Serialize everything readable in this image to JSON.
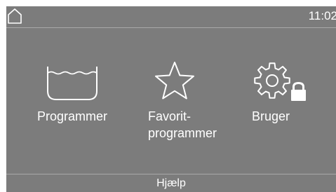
{
  "status_bar": {
    "home_icon": "home-icon",
    "time": "11:02"
  },
  "tiles": [
    {
      "icon": "tub-icon",
      "label_lines": [
        "Programmer"
      ]
    },
    {
      "icon": "star-icon",
      "label_lines": [
        "Favorit-",
        "programmer"
      ]
    },
    {
      "icon": "gear-lock-icon",
      "label_lines": [
        "Bruger"
      ]
    }
  ],
  "footer": {
    "help_label": "Hjælp"
  },
  "colors": {
    "page_background": "#ffffff",
    "screen_background": "#7c7c7c",
    "foreground": "#ffffff",
    "divider": "#a9a9a9"
  }
}
